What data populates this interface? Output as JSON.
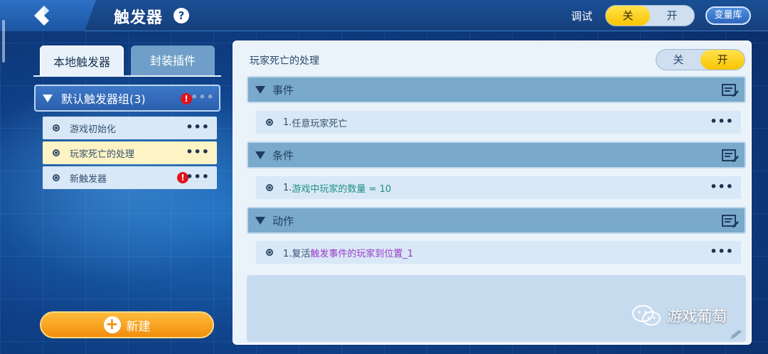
{
  "header": {
    "title": "触发器",
    "help_symbol": "?",
    "debug_label": "调试",
    "debug_off": "关",
    "debug_on": "开",
    "debug_state": "off",
    "variable_library": "变量库"
  },
  "left": {
    "tabs": [
      {
        "label": "本地触发器",
        "active": true
      },
      {
        "label": "封装插件",
        "active": false
      }
    ],
    "group": {
      "label": "默认触发器组(3)",
      "warning": "!",
      "more": "•••"
    },
    "items": [
      {
        "label": "游戏初始化",
        "more": "•••",
        "warning": null,
        "selected": false
      },
      {
        "label": "玩家死亡的处理",
        "more": "•••",
        "warning": null,
        "selected": true
      },
      {
        "label": "新触发器",
        "more": "•••",
        "warning": "!",
        "selected": false
      }
    ],
    "new_button": {
      "icon": "+",
      "label": "新建"
    }
  },
  "right": {
    "trigger_name": "玩家死亡的处理",
    "toggle": {
      "off": "关",
      "on": "开",
      "state": "on"
    },
    "sections": [
      {
        "label": "事件",
        "row_prefix": "1.",
        "row_text": "任意玩家死亡",
        "more": "•••"
      },
      {
        "label": "条件",
        "row_prefix": "1.",
        "row_text": "游戏中玩家的数量 = 10",
        "more": "•••"
      },
      {
        "label": "动作",
        "row_prefix": "1.复活",
        "row_text": "触发事件的玩家到位置_1",
        "more": "•••"
      }
    ]
  },
  "watermark": "游戏葡萄",
  "colors": {
    "accent_yellow": "#f9c400",
    "orange": "#f28e0c",
    "warning_red": "#e4121b",
    "condition_teal": "#1d8f86",
    "action_purple": "#9a3ac6"
  }
}
